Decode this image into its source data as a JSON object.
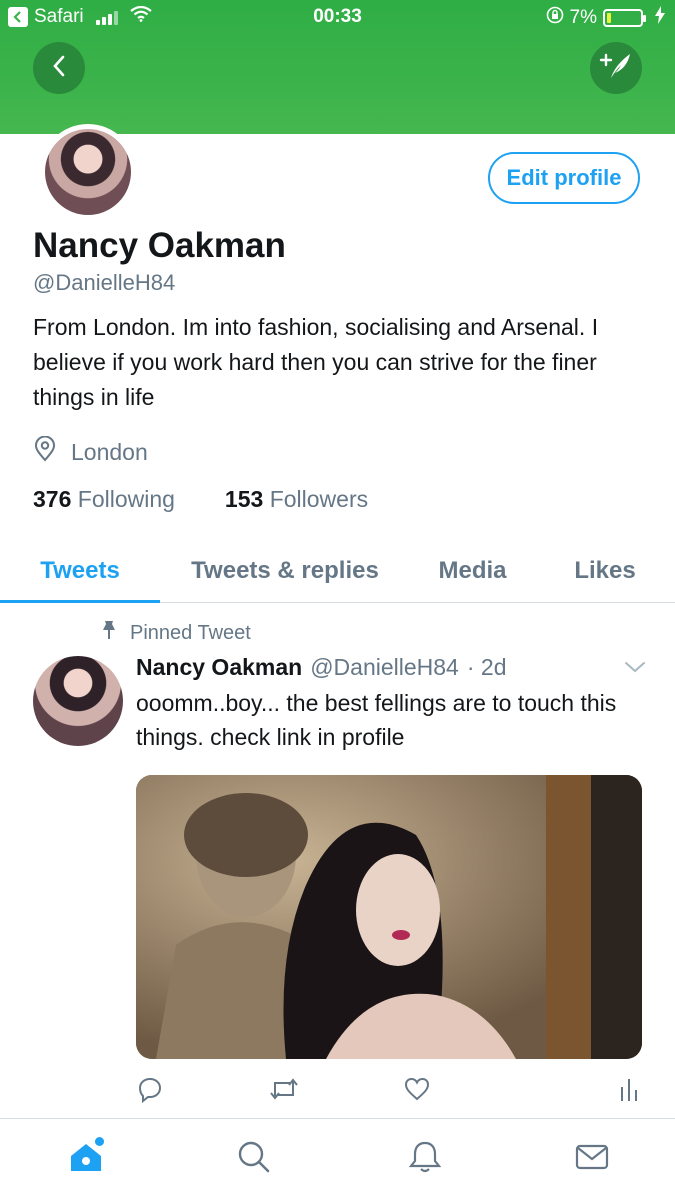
{
  "status_bar": {
    "carrier": "Safari",
    "time": "00:33",
    "battery_percent": "7%"
  },
  "profile": {
    "display_name": "Nancy Oakman",
    "handle": "@DanielleH84",
    "bio": "From London. Im into fashion, socialising and Arsenal. I believe if you work hard then you can strive for the finer things in life",
    "location": "London",
    "following_count": "376",
    "following_label": "Following",
    "followers_count": "153",
    "followers_label": "Followers",
    "edit_profile_label": "Edit profile"
  },
  "tabs": [
    {
      "label": "Tweets",
      "active": true
    },
    {
      "label": "Tweets & replies",
      "active": false
    },
    {
      "label": "Media",
      "active": false
    },
    {
      "label": "Likes",
      "active": false
    }
  ],
  "pinned_tweet": {
    "pinned_label": "Pinned Tweet",
    "author_name": "Nancy Oakman",
    "author_handle": "@DanielleH84",
    "time": "· 2d",
    "text": "ooomm..boy... the best fellings are to touch this things. check link in profile"
  },
  "icons": {
    "back": "chevron-left-icon",
    "compose": "compose-tweet-icon",
    "location": "location-pin-icon",
    "pin": "pin-icon",
    "reply": "reply-icon",
    "retweet": "retweet-icon",
    "like": "heart-icon",
    "analytics": "analytics-icon",
    "nav_home": "home-icon",
    "nav_search": "search-icon",
    "nav_notifications": "bell-icon",
    "nav_messages": "mail-icon"
  },
  "colors": {
    "header_green": "#3bb34a",
    "accent_blue": "#1da1f2",
    "muted_gray": "#657786"
  }
}
